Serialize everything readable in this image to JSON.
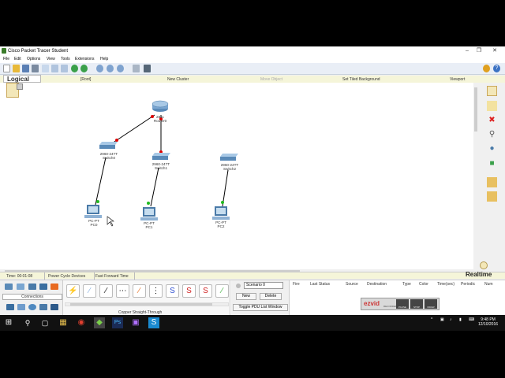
{
  "window": {
    "title": "Cisco Packet Tracer Student"
  },
  "menu": [
    "File",
    "Edit",
    "Options",
    "View",
    "Tools",
    "Extensions",
    "Help"
  ],
  "workspace_bar": {
    "mode": "Logical",
    "root": "[Root]",
    "new_cluster": "New Cluster",
    "move_object": "Move Object",
    "set_background": "Set Tiled Background",
    "viewport": "Viewport"
  },
  "devices": {
    "router": {
      "model": "2811",
      "name": "Router0"
    },
    "switch0": {
      "model": "2960-24TT",
      "name": "Switch0"
    },
    "switch1": {
      "model": "2960-24TT",
      "name": "Switch1"
    },
    "switch2": {
      "model": "2960-24TT",
      "name": "Switch2"
    },
    "pc0": {
      "model": "PC-PT",
      "name": "PC0"
    },
    "pc1": {
      "model": "PC-PT",
      "name": "PC1"
    },
    "pc2": {
      "model": "PC-PT",
      "name": "PC2"
    }
  },
  "link_colors": {
    "link": "#000000",
    "down": "#e00000",
    "up": "#22bb22"
  },
  "status_bar": {
    "time": "Time: 00:01:08",
    "power_cycle": "Power Cycle Devices",
    "fast_forward": "Fast Forward Time",
    "mode": "Realtime"
  },
  "device_panel": {
    "category_label": "Connections"
  },
  "cables": {
    "selected_label": "Copper Straight-Through"
  },
  "scenario": {
    "selected": "Scenario 0",
    "new_label": "New",
    "delete_label": "Delete",
    "toggle_label": "Toggle PDU List Window"
  },
  "pdu_columns": [
    "Fire",
    "Last Status",
    "Source",
    "Destination",
    "Type",
    "Color",
    "Time(sec)",
    "Periodic",
    "Num"
  ],
  "recorder": {
    "brand": "ezvid",
    "subtitle": "RECORDER",
    "pause": "PAUSE",
    "stop": "STOP",
    "draw": "DRAW"
  },
  "taskbar": {
    "time": "9:48 PM",
    "date": "12/10/2016"
  }
}
